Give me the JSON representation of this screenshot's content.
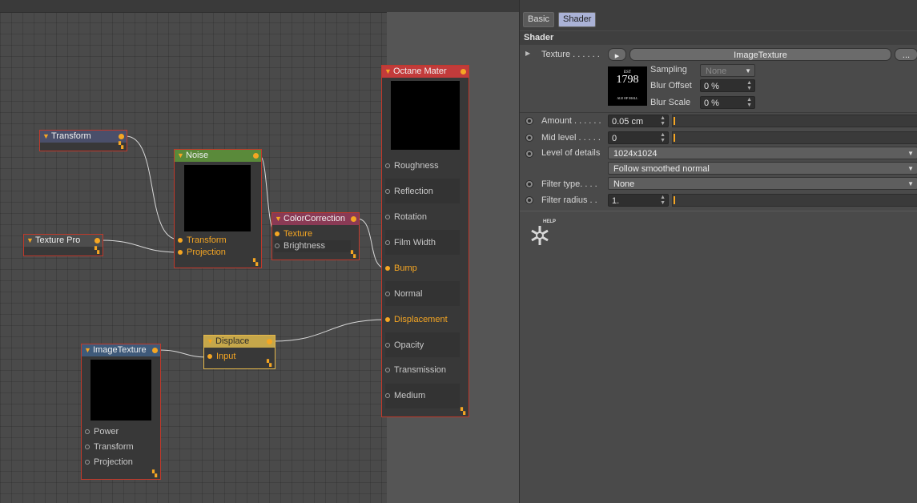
{
  "nodes": {
    "transform": {
      "title": "Transform"
    },
    "texture_pro": {
      "title": "Texture Pro"
    },
    "noise": {
      "title": "Noise",
      "ports": [
        "Transform",
        "Projection"
      ]
    },
    "color_correction": {
      "title": "ColorCorrection",
      "ports": [
        "Texture",
        "Brightness"
      ]
    },
    "octane_material": {
      "title": "Octane Mater",
      "ports": [
        "Roughness",
        "Reflection",
        "Rotation",
        "Film Width",
        "Bump",
        "Normal",
        "Displacement",
        "Opacity",
        "Transmission",
        "Medium"
      ]
    },
    "displace": {
      "title": "Displace",
      "ports": [
        "Input"
      ]
    },
    "image_texture": {
      "title": "ImageTexture",
      "ports": [
        "Power",
        "Transform",
        "Projection"
      ]
    }
  },
  "panel": {
    "tabs": [
      "Basic",
      "Shader"
    ],
    "active_tab": "Shader",
    "section_title": "Shader",
    "texture": {
      "label": "Texture . . . . . .",
      "button": "ImageTexture",
      "more": "...",
      "thumb_small": "EST",
      "thumb_year": "1798",
      "thumb_bottom": "ALE OF MALL"
    },
    "sampling": {
      "label": "Sampling",
      "value": "None"
    },
    "blur_offset": {
      "label": "Blur Offset",
      "value": "0 %"
    },
    "blur_scale": {
      "label": "Blur Scale",
      "value": "0 %"
    },
    "amount": {
      "label": "Amount . . . . . .",
      "value": "0.05 cm"
    },
    "mid_level": {
      "label": "Mid level . . . . .",
      "value": "0"
    },
    "level_of_details": {
      "label": "Level of details",
      "value": "1024x1024"
    },
    "normal_mode": {
      "value": "Follow smoothed normal"
    },
    "filter_type": {
      "label": "Filter type. . . .",
      "value": "None"
    },
    "filter_radius": {
      "label": "Filter radius . .",
      "value": "1."
    },
    "help": {
      "label": "HELP"
    }
  },
  "colors": {
    "accent": "#f5a623",
    "node_border": "#c0392b",
    "selected_border": "#e6b84a",
    "noise_header": "#5a8a3a",
    "octane_header": "#c23b3b",
    "cc_header": "#8a3a55",
    "displace_header": "#c6a74a",
    "transform_header": "#4a4f6a",
    "imagetex_header": "#3f5a7a",
    "active_tab": "#aab2d6"
  }
}
